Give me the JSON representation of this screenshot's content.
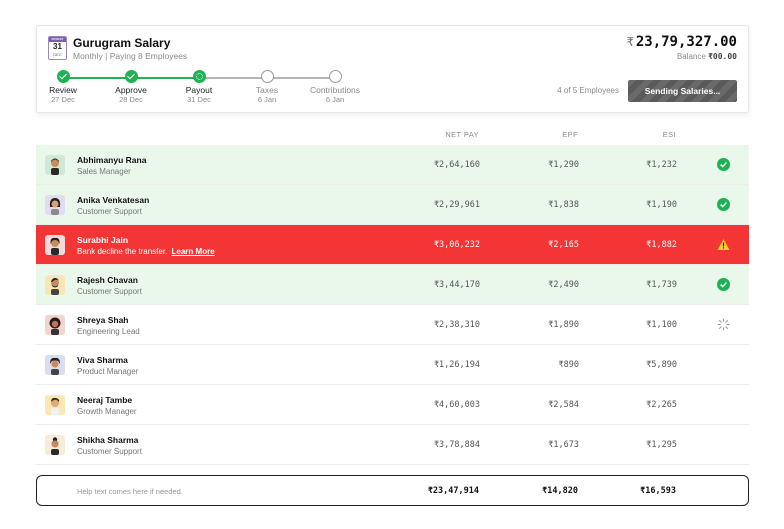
{
  "header": {
    "calendar": {
      "tag": "PAYDAY",
      "day": "31",
      "month": "DEC"
    },
    "title": "Gurugram Salary",
    "subtitle": "Monthly | Paying 8 Employees",
    "total_symbol": "₹",
    "total": "23,79,327.00",
    "balance_label": "Balance",
    "balance_value": "₹00.00",
    "employees_status": "4 of 5 Employees",
    "action_button": "Sending Salaries..."
  },
  "steps": [
    {
      "label": "Review",
      "date": "27 Dec",
      "state": "done"
    },
    {
      "label": "Approve",
      "date": "28 Dec",
      "state": "done"
    },
    {
      "label": "Payout",
      "date": "31 Dec",
      "state": "active"
    },
    {
      "label": "Taxes",
      "date": "6 Jan",
      "state": "todo"
    },
    {
      "label": "Contributions",
      "date": "6 Jan",
      "state": "todo"
    }
  ],
  "columns": {
    "net_pay": "NET PAY",
    "epf": "EPF",
    "esi": "ESI"
  },
  "rows": [
    {
      "name": "Abhimanyu Rana",
      "role": "Sales Manager",
      "net_pay": "₹2,64,160",
      "epf": "₹1,290",
      "esi": "₹1,232",
      "status": "success"
    },
    {
      "name": "Anika Venkatesan",
      "role": "Customer Support",
      "net_pay": "₹2,29,961",
      "epf": "₹1,838",
      "esi": "₹1,190",
      "status": "success"
    },
    {
      "name": "Surabhi Jain",
      "role": "Bank decline the transfer.",
      "link": "Learn More",
      "net_pay": "₹3,06,232",
      "epf": "₹2,165",
      "esi": "₹1,882",
      "status": "error"
    },
    {
      "name": "Rajesh Chavan",
      "role": "Customer Support",
      "net_pay": "₹3,44,170",
      "epf": "₹2,490",
      "esi": "₹1,739",
      "status": "success"
    },
    {
      "name": "Shreya Shah",
      "role": "Engineering Lead",
      "net_pay": "₹2,38,310",
      "epf": "₹1,890",
      "esi": "₹1,100",
      "status": "processing"
    },
    {
      "name": "Viva Sharma",
      "role": "Product Manager",
      "net_pay": "₹1,26,194",
      "epf": "₹890",
      "esi": "₹5,890",
      "status": "pending"
    },
    {
      "name": "Neeraj Tambe",
      "role": "Growth Manager",
      "net_pay": "₹4,60,003",
      "epf": "₹2,584",
      "esi": "₹2,265",
      "status": "pending"
    },
    {
      "name": "Shikha Sharma",
      "role": "Customer Support",
      "net_pay": "₹3,78,884",
      "epf": "₹1,673",
      "esi": "₹1,295",
      "status": "pending"
    }
  ],
  "footer": {
    "help_text": "Help text comes here if needed.",
    "total_net_pay": "₹23,47,914",
    "total_epf": "₹14,820",
    "total_esi": "₹16,593"
  },
  "colors": {
    "success": "#1fb154",
    "success_row": "#eaf8ec",
    "error_row": "#f43535",
    "warning": "#ffcf2e",
    "accent_purple": "#7c5cb8"
  }
}
